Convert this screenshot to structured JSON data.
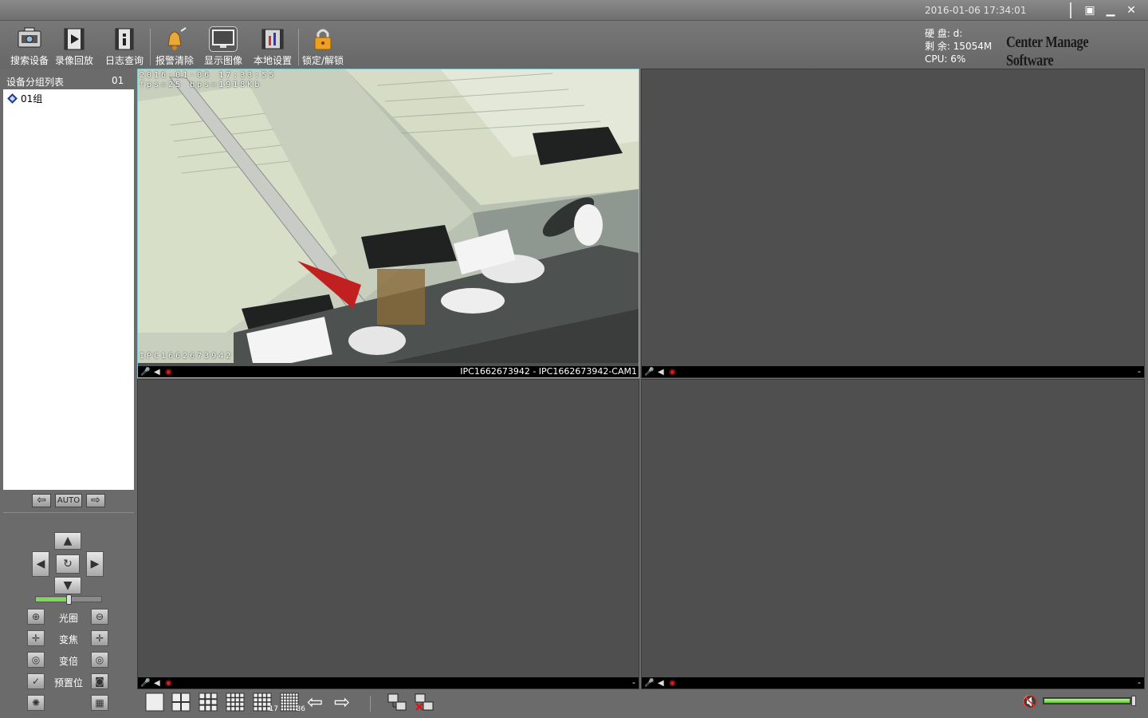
{
  "titlebar": {
    "datetime": "2016-01-06 17:34:01",
    "maximize_glyph": "▣",
    "minimize_glyph": "▁",
    "close_glyph": "✕"
  },
  "toolbar": {
    "items": [
      {
        "label": "搜索设备",
        "icon": "search-device-icon"
      },
      {
        "label": "录像回放",
        "icon": "playback-icon"
      },
      {
        "label": "日志查询",
        "icon": "log-query-icon"
      },
      {
        "label": "报警清除",
        "icon": "alarm-clear-icon"
      },
      {
        "label": "显示图像",
        "icon": "display-image-icon"
      },
      {
        "label": "本地设置",
        "icon": "local-settings-icon"
      },
      {
        "label": "锁定/解锁",
        "icon": "lock-icon"
      }
    ],
    "active_index": 4
  },
  "system_info": {
    "disk": "硬 盘: d:",
    "free": "剩 余: 15054M",
    "cpu": "CPU: 6%"
  },
  "brand": "Center Manage Software",
  "device_panel": {
    "title": "设备分组列表",
    "number": "01",
    "groups": [
      "01组"
    ]
  },
  "group_nav": {
    "prev": "⇦",
    "auto": "AUTO",
    "next": "⇨"
  },
  "ptz": {
    "up": "▲",
    "down": "▼",
    "left": "◀",
    "right": "▶",
    "center": "↻",
    "speed_fraction": 0.5,
    "rows": [
      {
        "label": "光圈",
        "left_icon": "iris-open-icon",
        "right_icon": "iris-close-icon",
        "left_glyph": "⊕",
        "right_glyph": "⊖"
      },
      {
        "label": "变焦",
        "left_icon": "focus-near-icon",
        "right_icon": "focus-far-icon",
        "left_glyph": "✛",
        "right_glyph": "✛"
      },
      {
        "label": "变倍",
        "left_icon": "zoom-in-icon",
        "right_icon": "zoom-out-icon",
        "left_glyph": "◎",
        "right_glyph": "◎"
      },
      {
        "label": "预置位",
        "left_icon": "preset-set-icon",
        "right_icon": "preset-call-icon",
        "left_glyph": "✓",
        "right_glyph": "◙"
      },
      {
        "label": "",
        "left_icon": "light-icon",
        "right_icon": "wiper-icon",
        "left_glyph": "✺",
        "right_glyph": "▦"
      }
    ]
  },
  "channels": [
    {
      "active": true,
      "has_video": true,
      "osd_top": "2016-01-06 17:33:55",
      "osd_rate": "fps=25 bps=1918Kb",
      "osd_bottom": "IPC1662673942",
      "status_label": "IPC1662673942 - IPC1662673942-CAM1"
    },
    {
      "active": false,
      "has_video": false,
      "status_label": "-"
    },
    {
      "active": false,
      "has_video": false,
      "status_label": "-"
    },
    {
      "active": false,
      "has_video": false,
      "status_label": "-"
    }
  ],
  "bottom_bar": {
    "layouts": [
      "1",
      "4",
      "9",
      "16",
      "17",
      "36"
    ],
    "layout_17_label": "17",
    "layout_36_label": "36",
    "prev_page": "⇦",
    "next_page": "⇨",
    "volume_fraction": 0.95
  }
}
